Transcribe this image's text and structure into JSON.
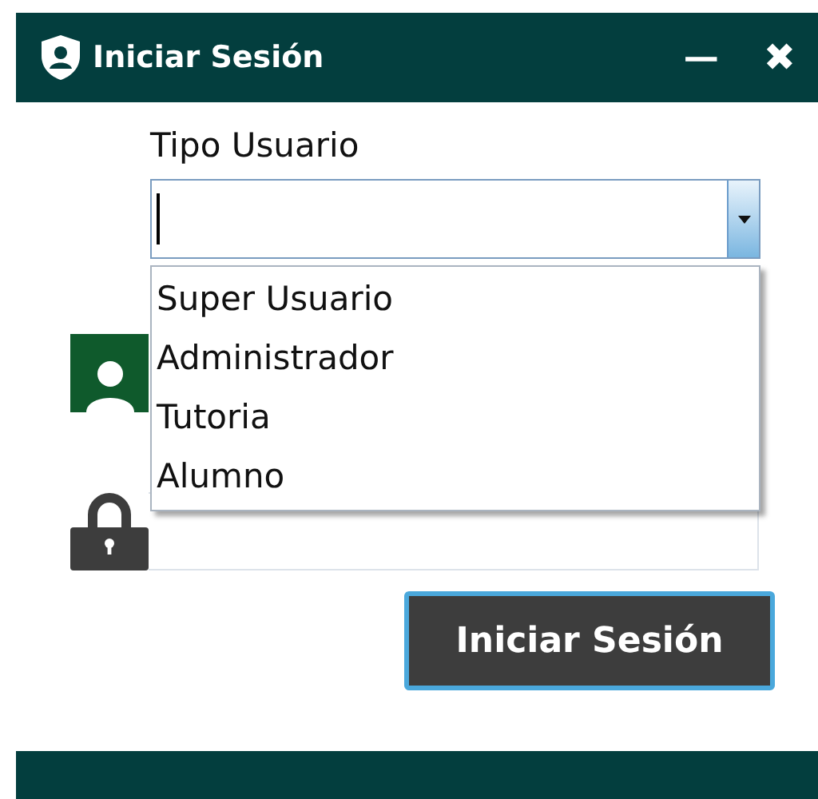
{
  "window": {
    "title": "Iniciar Sesión",
    "minimize": "—",
    "close": "✖"
  },
  "user_type": {
    "label": "Tipo Usuario",
    "expanded": true,
    "options": [
      {
        "label": "Super Usuario",
        "selected": false
      },
      {
        "label": "Administrador",
        "selected": false
      },
      {
        "label": "Tutoria",
        "selected": false
      },
      {
        "label": "Alumno",
        "selected": false
      }
    ]
  },
  "login_button": "Iniciar Sesión"
}
